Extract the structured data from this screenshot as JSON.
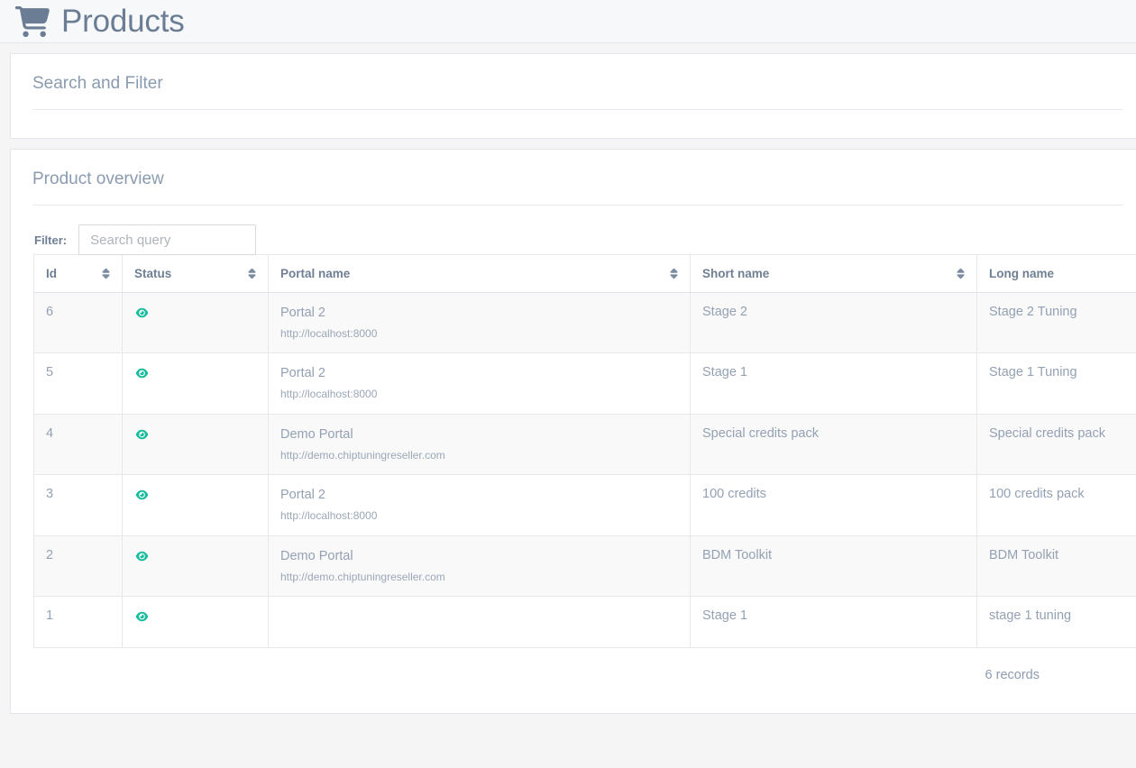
{
  "header": {
    "title": "Products",
    "icon": "shopping-cart-icon"
  },
  "search_panel": {
    "heading": "Search and Filter"
  },
  "overview_panel": {
    "heading": "Product overview",
    "filter": {
      "label": "Filter:",
      "value": "",
      "placeholder": "Search query"
    },
    "table": {
      "columns": [
        {
          "label": "Id",
          "sortable": true,
          "sort_icon": "sort-icon"
        },
        {
          "label": "Status",
          "sortable": true,
          "sort_icon": "sort-icon"
        },
        {
          "label": "Portal name",
          "sortable": true,
          "sort_icon": "sort-icon"
        },
        {
          "label": "Short name",
          "sortable": true,
          "sort_icon": "sort-icon"
        },
        {
          "label": "Long name",
          "sortable": false,
          "sort_icon": ""
        }
      ],
      "rows": [
        {
          "id": "6",
          "status_icon": "eye-icon",
          "portal_name": "Portal 2",
          "portal_url": "http://localhost:8000",
          "short_name": "Stage 2",
          "long_name": "Stage 2 Tuning"
        },
        {
          "id": "5",
          "status_icon": "eye-icon",
          "portal_name": "Portal 2",
          "portal_url": "http://localhost:8000",
          "short_name": "Stage 1",
          "long_name": "Stage 1 Tuning"
        },
        {
          "id": "4",
          "status_icon": "eye-icon",
          "portal_name": "Demo Portal",
          "portal_url": "http://demo.chiptuningreseller.com",
          "short_name": "Special credits pack",
          "long_name": "Special credits pack"
        },
        {
          "id": "3",
          "status_icon": "eye-icon",
          "portal_name": "Portal 2",
          "portal_url": "http://localhost:8000",
          "short_name": "100 credits",
          "long_name": "100 credits pack"
        },
        {
          "id": "2",
          "status_icon": "eye-icon",
          "portal_name": "Demo Portal",
          "portal_url": "http://demo.chiptuningreseller.com",
          "short_name": "BDM Toolkit",
          "long_name": "BDM Toolkit"
        },
        {
          "id": "1",
          "status_icon": "eye-icon",
          "portal_name": "",
          "portal_url": "",
          "short_name": "Stage 1",
          "long_name": "stage 1 tuning"
        }
      ],
      "record_count_text": "6 records"
    }
  },
  "colors": {
    "page_background": "#f5f5f5",
    "panel_background": "#ffffff",
    "title_text": "#6b7d94",
    "heading_text": "#8a9bb0",
    "body_text": "#93a1b3",
    "status_icon": "#1abc9c",
    "border": "#e6e8ec",
    "stripe": "#f9f9fa"
  }
}
